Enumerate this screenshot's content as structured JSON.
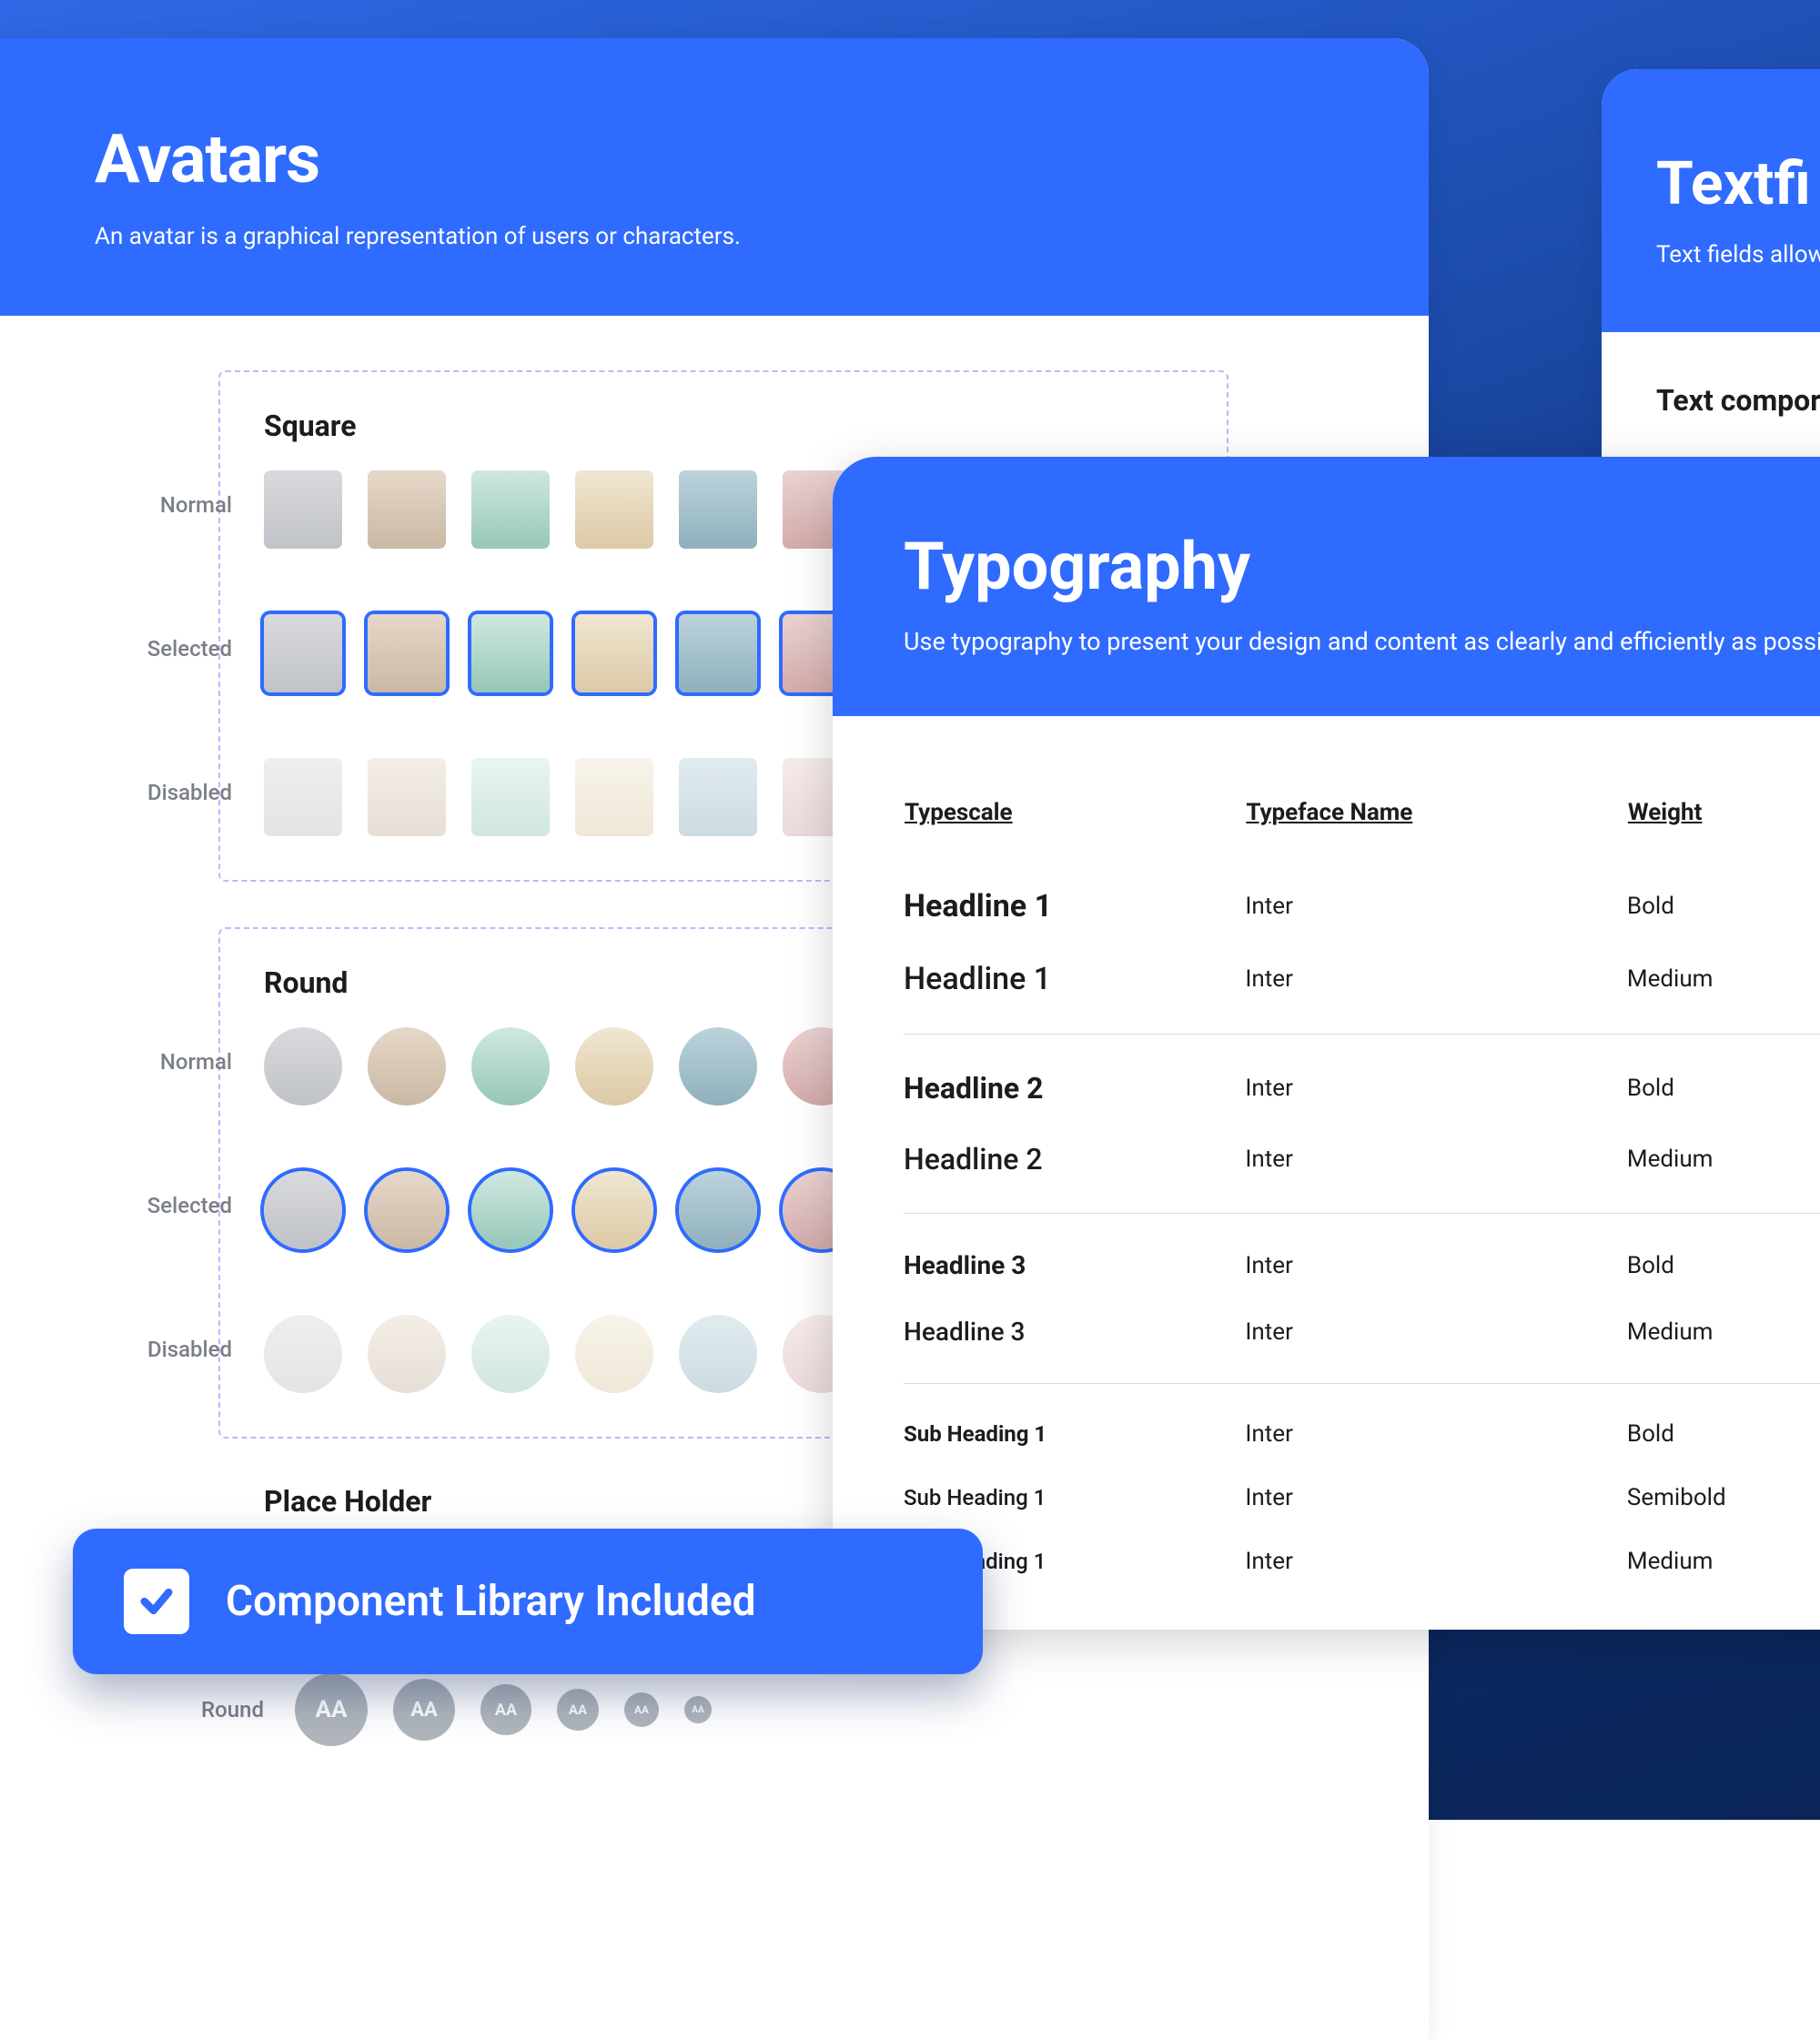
{
  "avatars_card": {
    "title": "Avatars",
    "subtitle": "An avatar is a graphical representation of users or characters.",
    "sections": {
      "square": "Square",
      "round": "Round",
      "placeholder": "Place Holder"
    },
    "row_labels": {
      "normal": "Normal",
      "selected": "Selected",
      "disabled": "Disabled",
      "round": "Round"
    },
    "placeholder_text": "AA"
  },
  "textfields_card": {
    "title": "Textfi",
    "subtitle": "Text fields allow u",
    "section_heading": "Text compor"
  },
  "typography_card": {
    "title": "Typography",
    "subtitle": "Use typography to present your design and content as clearly and efficiently as possible.",
    "columns": {
      "typescale": "Typescale",
      "typeface": "Typeface Name",
      "weight": "Weight"
    },
    "rows": [
      {
        "scale": "Headline 1",
        "face": "Inter",
        "weight": "Bold",
        "cls": "ts-h1"
      },
      {
        "scale": "Headline 1",
        "face": "Inter",
        "weight": "Medium",
        "cls": "ts-h1m",
        "sep": true
      },
      {
        "scale": "Headline 2",
        "face": "Inter",
        "weight": "Bold",
        "cls": "ts-h2",
        "gap": true
      },
      {
        "scale": "Headline 2",
        "face": "Inter",
        "weight": "Medium",
        "cls": "ts-h2m",
        "sep": true
      },
      {
        "scale": "Headline 3",
        "face": "Inter",
        "weight": "Bold",
        "cls": "ts-h3",
        "gap": true
      },
      {
        "scale": "Headline 3",
        "face": "Inter",
        "weight": "Medium",
        "cls": "ts-h3m",
        "sep": true
      },
      {
        "scale": "Sub Heading 1",
        "face": "Inter",
        "weight": "Bold",
        "cls": "ts-sh",
        "gap": true
      },
      {
        "scale": "Sub Heading 1",
        "face": "Inter",
        "weight": "Semibold",
        "cls": "ts-shm"
      },
      {
        "scale": "Sub Heading 1",
        "face": "Inter",
        "weight": "Medium",
        "cls": "ts-shm"
      }
    ]
  },
  "banner": {
    "label": "Component Library Included"
  }
}
